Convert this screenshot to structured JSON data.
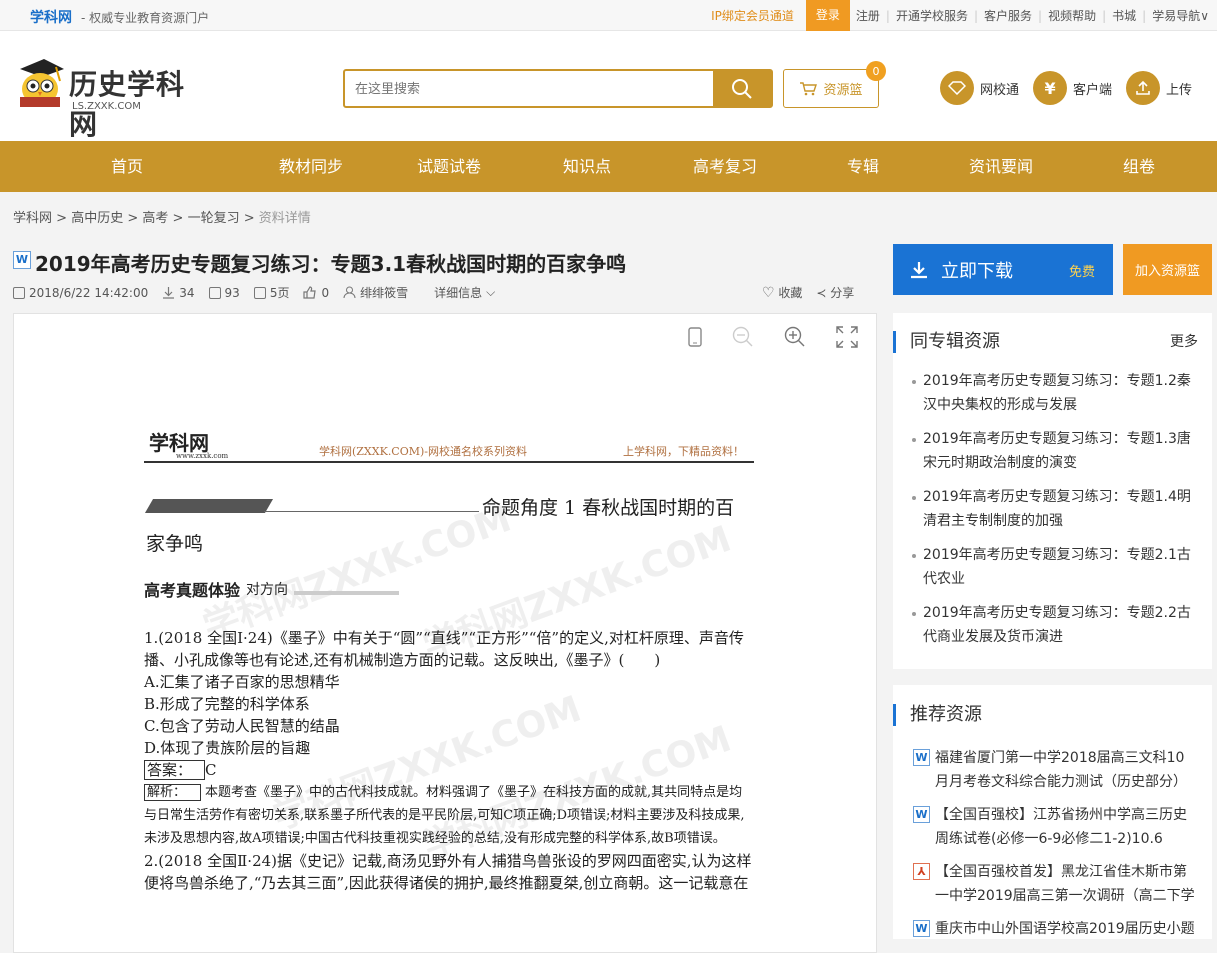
{
  "topbar": {
    "brand": "学科网",
    "slogan": "- 权威专业教育资源门户",
    "links": [
      "IP绑定会员通道",
      "登录",
      "注册",
      "开通学校服务",
      "客户服务",
      "视频帮助",
      "书城",
      "学易导航∨"
    ]
  },
  "header": {
    "logo_name": "历史学科网",
    "logo_url": "LS.ZXXK.COM",
    "search_placeholder": "在这里搜索",
    "basket_label": "资源篮",
    "basket_count": "0",
    "links": [
      {
        "label": "网校通",
        "icon": "diamond-icon"
      },
      {
        "label": "客户端",
        "icon": "yen-icon"
      },
      {
        "label": "上传",
        "icon": "upload-icon"
      }
    ]
  },
  "nav": [
    "首页",
    "教材同步",
    "试题试卷",
    "知识点",
    "高考复习",
    "专辑",
    "资讯要闻",
    "组卷"
  ],
  "breadcrumb": [
    "学科网",
    "高中历史",
    "高考",
    "一轮复习",
    "资料详情"
  ],
  "doc": {
    "title": "2019年高考历史专题复习练习：专题3.1春秋战国时期的百家争鸣",
    "date": "2018/6/22 14:42:00",
    "downloads": "34",
    "views": "93",
    "pages": "5页",
    "likes": "0",
    "author": "绯绯筱雪",
    "detail": "详细信息",
    "favorite": "收藏",
    "share": "分享"
  },
  "preview": {
    "logo": "学科网",
    "logo_sub": "www.zxxk.com",
    "header_mid": "学科网(ZXXK.COM)-网校通名校系列资料",
    "header_right": "上学科网，下精品资料！",
    "heading1": "命题角度 1  春秋战国时期的百",
    "heading2": "家争鸣",
    "section": "高考真题体验",
    "section_sub": "对方向",
    "q1": "1.(2018 全国Ⅰ·24)《墨子》中有关于“圆”“直线”“正方形”“倍”的定义,对杠杆原理、声音传播、小孔成像等也有论述,还有机械制造方面的记载。这反映出,《墨子》(　　)",
    "options": [
      "A.汇集了诸子百家的思想精华",
      "B.形成了完整的科学体系",
      "C.包含了劳动人民智慧的结晶",
      "D.体现了贵族阶层的旨趣"
    ],
    "answer_label": "答案：",
    "answer": "C",
    "analysis_label": "解析：",
    "analysis": "本题考查《墨子》中的古代科技成就。材料强调了《墨子》在科技方面的成就,其共同特点是均与日常生活劳作有密切关系,联系墨子所代表的是平民阶层,可知C项正确;D项错误;材料主要涉及科技成果,未涉及思想内容,故A项错误;中国古代科技重视实践经验的总结,没有形成完整的科学体系,故B项错误。",
    "q2": "2.(2018 全国Ⅱ·24)据《史记》记载,商汤见野外有人捕猎鸟兽张设的罗网四面密实,认为这样便将鸟兽杀绝了,“乃去其三面”,因此获得诸侯的拥护,最终推翻夏桀,创立商朝。这一记载意在",
    "watermark": "学科网ZXXK.COM"
  },
  "download": {
    "label": "立即下载",
    "free": "免费",
    "add": "加入资源篮"
  },
  "same_series": {
    "title": "同专辑资源",
    "more": "更多",
    "items": [
      "2019年高考历史专题复习练习：专题1.2秦汉中央集权的形成与发展",
      "2019年高考历史专题复习练习：专题1.3唐宋元时期政治制度的演变",
      "2019年高考历史专题复习练习：专题1.4明清君主专制制度的加强",
      "2019年高考历史专题复习练习：专题2.1古代农业",
      "2019年高考历史专题复习练习：专题2.2古代商业发展及货币演进"
    ]
  },
  "recommend": {
    "title": "推荐资源",
    "items": [
      {
        "type": "W",
        "text": "福建省厦门第一中学2018届高三文科10月月考卷文科综合能力测试（历史部分）"
      },
      {
        "type": "W",
        "text": "【全国百强校】江苏省扬州中学高三历史周练试卷(必修一6-9必修二1-2)10.6"
      },
      {
        "type": "PDF",
        "text": "【全国百强校首发】黑龙江省佳木斯市第一中学2019届高三第一次调研（高二下学"
      },
      {
        "type": "W",
        "text": "重庆市中山外国语学校高2019届历史小题"
      }
    ]
  },
  "colors": {
    "gold": "#c8952a",
    "blue": "#1a73d4",
    "orange": "#f09a22"
  }
}
